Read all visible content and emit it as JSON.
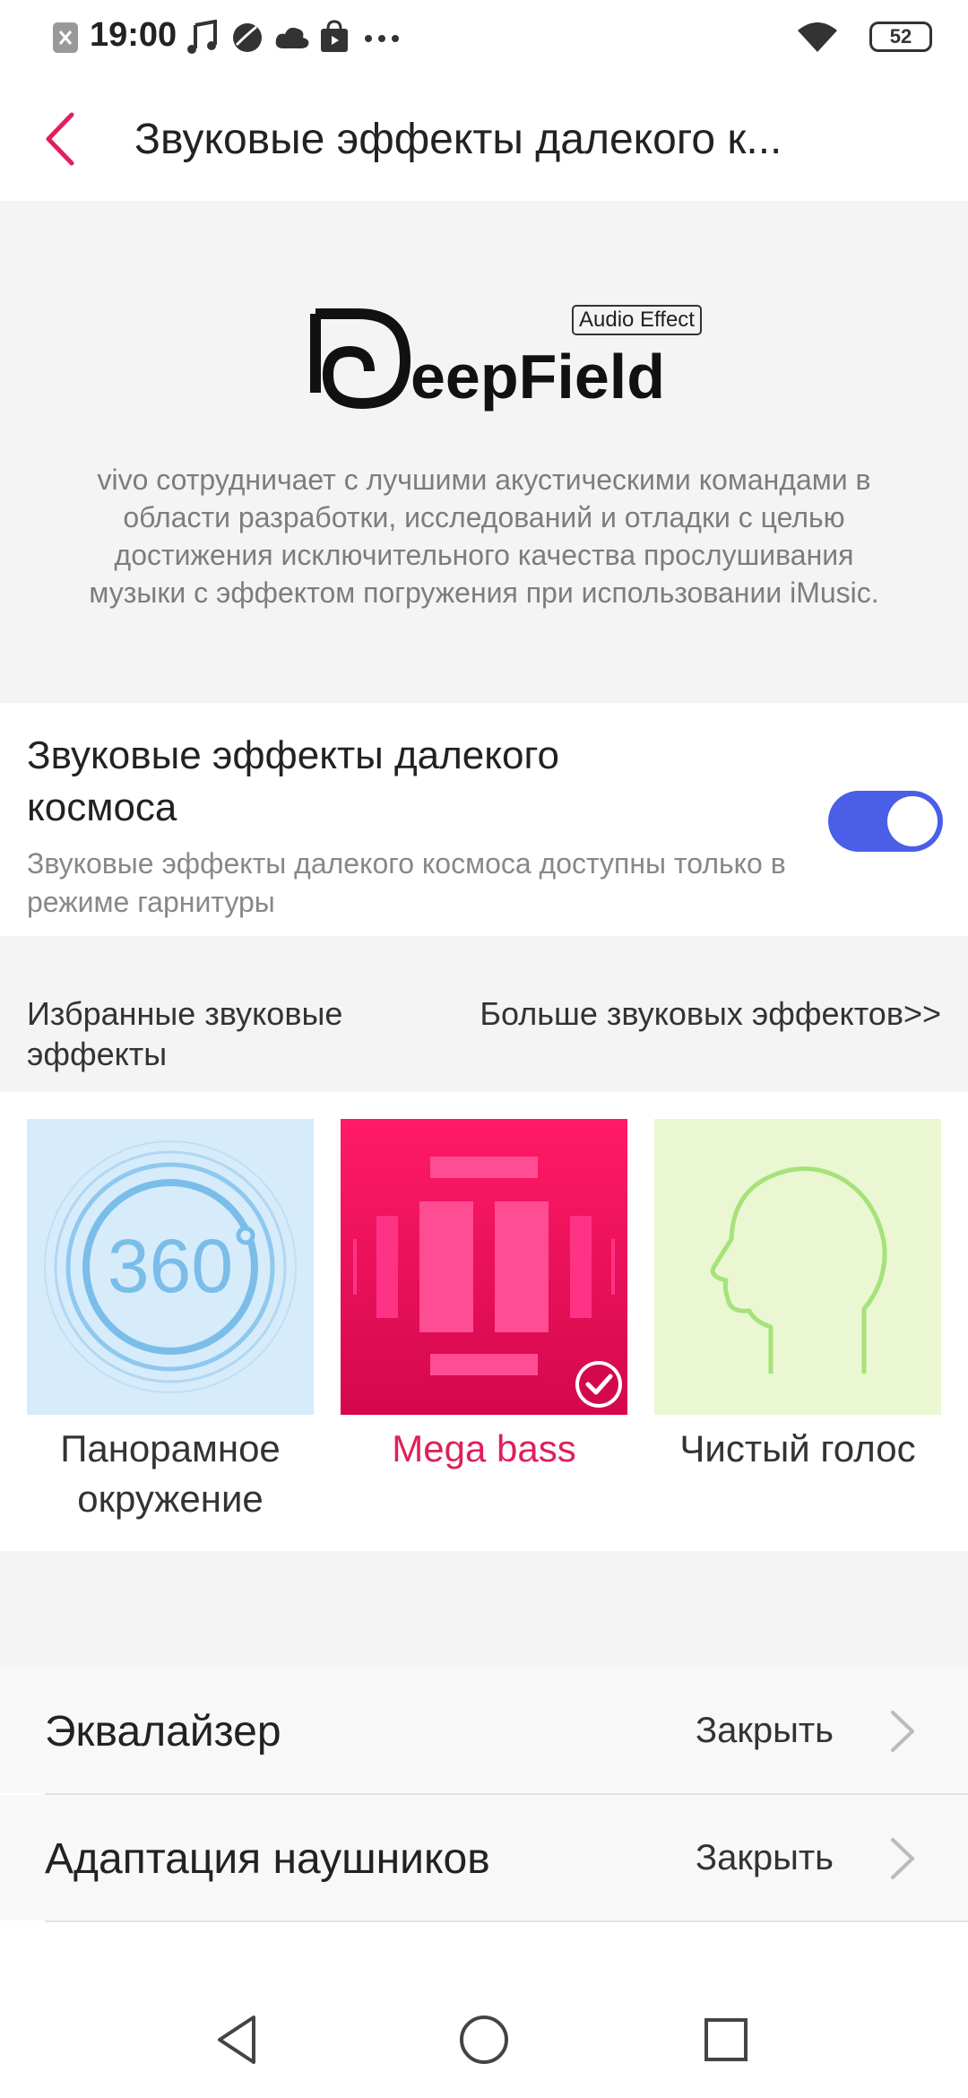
{
  "status_bar": {
    "time": "19:00",
    "battery": "52"
  },
  "header": {
    "title": "Звуковые эффекты далекого к..."
  },
  "hero": {
    "brand": "DeepField",
    "brand_badge": "Audio Effect",
    "description": "vivo сотрудничает с лучшими акустическими командами в области разработки, исследований и отладки с целью достижения исключительного качества прослушивания музыки с эффектом погружения при использовании iMusic."
  },
  "deep_space": {
    "title": "Звуковые эффекты далекого космоса",
    "subtitle": "Звуковые эффекты далекого космоса доступны только в режиме гарнитуры",
    "enabled": true
  },
  "favorites": {
    "label": "Избранные звуковые эффекты",
    "more_link": "Больше звуковых эффектов>>"
  },
  "effects": [
    {
      "label": "Панорамное окружение",
      "icon": "360-surround-icon",
      "badge": "360",
      "color": "#d6ecfb",
      "selected": false
    },
    {
      "label": "Mega bass",
      "icon": "mega-bass-icon",
      "color": "#e8105a",
      "selected": true
    },
    {
      "label": "Чистый голос",
      "icon": "clear-voice-head-icon",
      "color": "#ebf7d2",
      "selected": false
    }
  ],
  "settings": [
    {
      "label": "Эквалайзер",
      "value": "Закрыть"
    },
    {
      "label": "Адаптация наушников",
      "value": "Закрыть"
    }
  ],
  "colors": {
    "accent": "#e01f5b",
    "toggle_on": "#4a5ee8"
  }
}
